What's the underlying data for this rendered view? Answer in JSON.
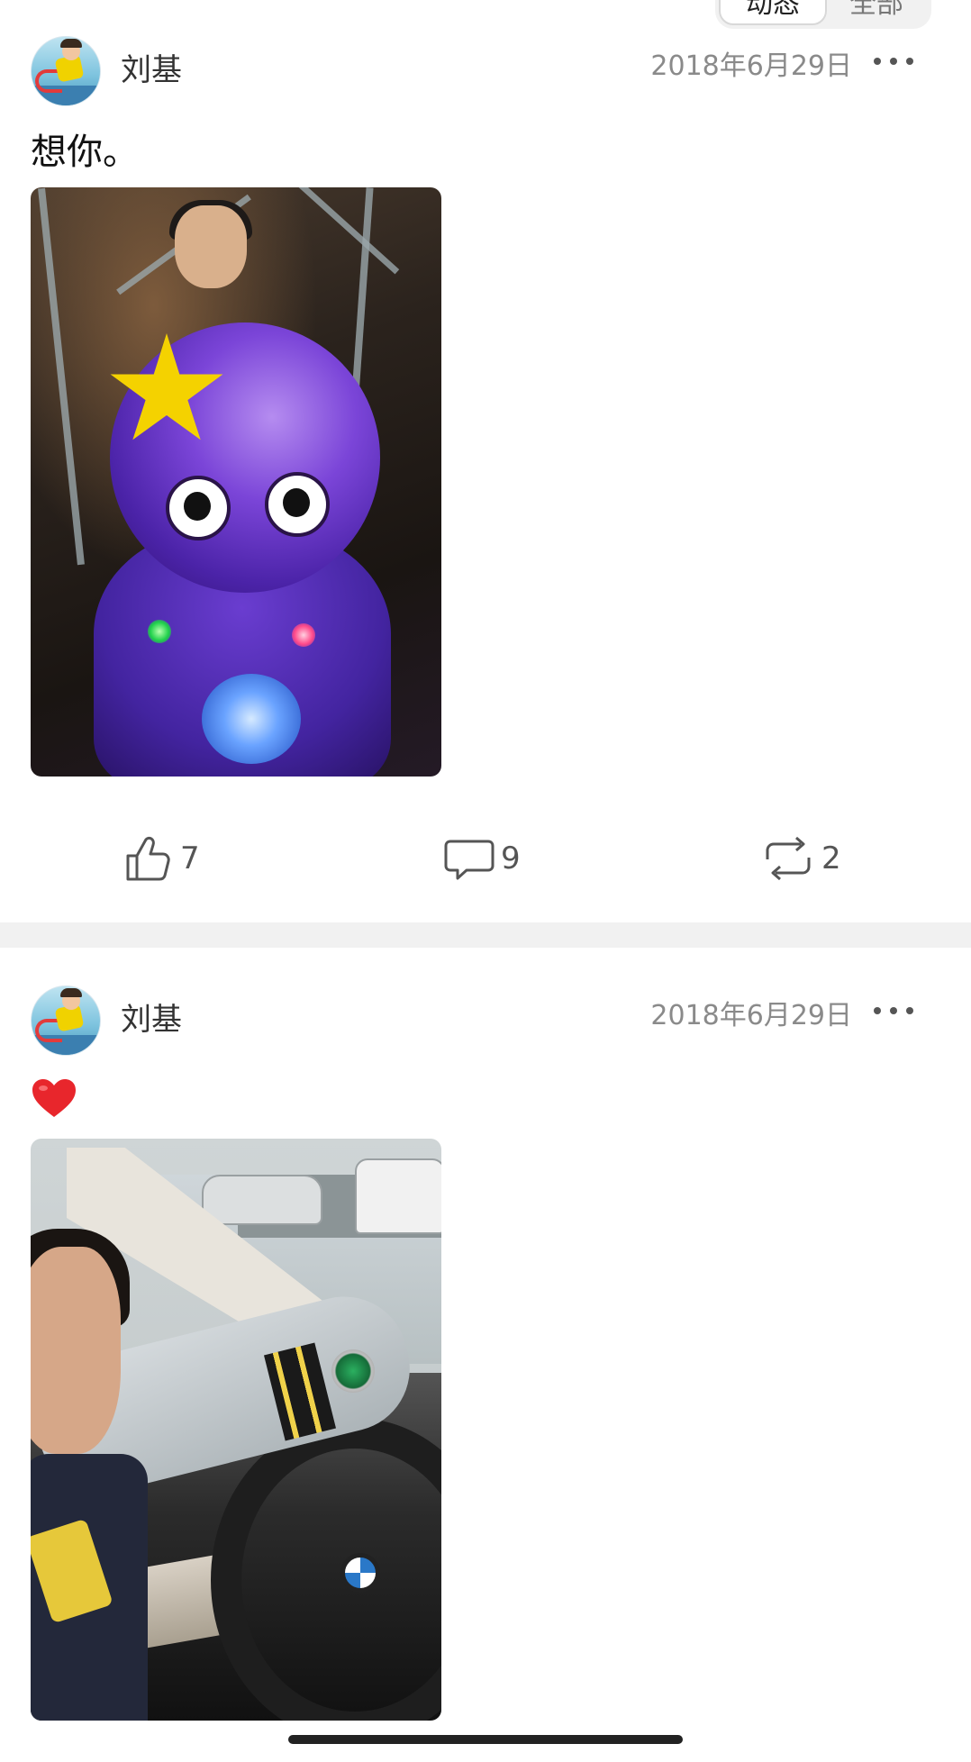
{
  "tabs": {
    "dynamic_label": "动态",
    "all_label": "全部"
  },
  "posts": [
    {
      "username": "刘基",
      "date": "2018年6月29日",
      "text": "想你。",
      "likes": "7",
      "comments": "9",
      "reposts": "2"
    },
    {
      "username": "刘基",
      "date": "2018年6月29日",
      "text": ""
    }
  ],
  "icons": {
    "more": "more-icon",
    "like": "thumbs-up-icon",
    "comment": "comment-icon",
    "repost": "repost-icon",
    "heart": "red-heart-emoji"
  },
  "colors": {
    "heart": "#e8262c",
    "meta_text": "#8a8a8a",
    "divider": "#f1f1f1"
  }
}
